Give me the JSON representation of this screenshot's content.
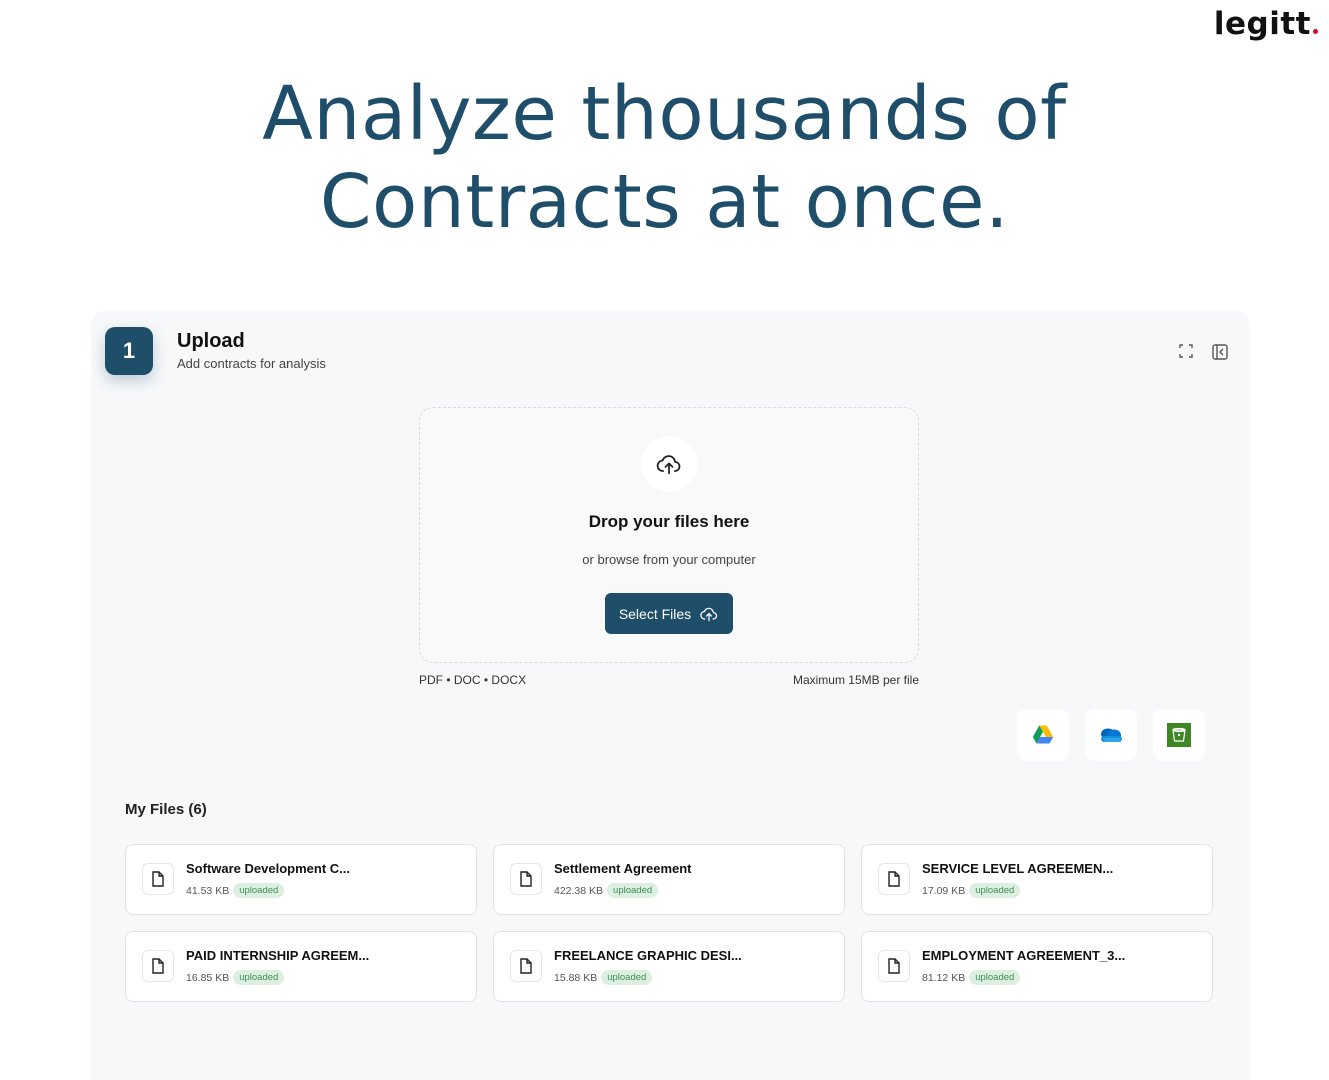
{
  "brand": {
    "name": "legitt",
    "dot_color": "#c8102e"
  },
  "hero": {
    "line1": "Analyze thousands of",
    "line2": "Contracts at once."
  },
  "upload": {
    "step_number": "1",
    "title": "Upload",
    "subtitle": "Add contracts for analysis",
    "drop_title": "Drop your files here",
    "drop_subtitle": "or browse from your computer",
    "select_button": "Select Files",
    "formats": "PDF • DOC • DOCX",
    "max_size": "Maximum 15MB per file",
    "integrations": [
      "google-drive-icon",
      "onedrive-icon",
      "s3-bucket-icon"
    ]
  },
  "files": {
    "title": "My Files (6)",
    "items": [
      {
        "name": "Software Development C...",
        "size": "41.53 KB",
        "status": "uploaded"
      },
      {
        "name": "Settlement Agreement",
        "size": "422.38 KB",
        "status": "uploaded"
      },
      {
        "name": "SERVICE LEVEL AGREEMEN...",
        "size": "17.09 KB",
        "status": "uploaded"
      },
      {
        "name": "PAID INTERNSHIP AGREEM...",
        "size": "16.85 KB",
        "status": "uploaded"
      },
      {
        "name": "FREELANCE GRAPHIC DESI...",
        "size": "15.88 KB",
        "status": "uploaded"
      },
      {
        "name": "EMPLOYMENT AGREEMENT_3...",
        "size": "81.12 KB",
        "status": "uploaded"
      }
    ]
  },
  "colors": {
    "accent": "#1f4e6b",
    "badge_bg": "#dcefe0",
    "badge_text": "#3e8f55"
  }
}
